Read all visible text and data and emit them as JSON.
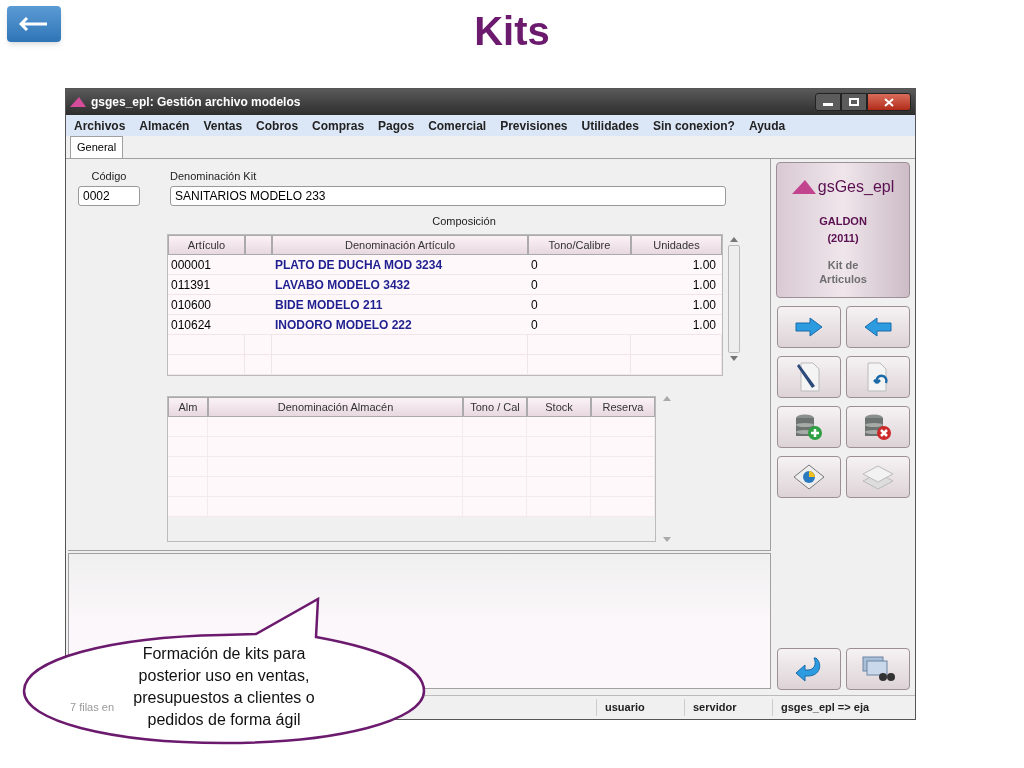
{
  "slide": {
    "title": "Kits"
  },
  "window": {
    "title": "gsges_epl: Gestión archivo modelos"
  },
  "menu": [
    "Archivos",
    "Almacén",
    "Ventas",
    "Cobros",
    "Compras",
    "Pagos",
    "Comercial",
    "Previsiones",
    "Utilidades",
    "Sin conexion?",
    "Ayuda"
  ],
  "tabs": [
    {
      "label": "General",
      "selected": true
    }
  ],
  "fields": [
    {
      "label": "Código",
      "value": "0002"
    },
    {
      "label": "Denominación Kit",
      "value": "SANITARIOS MODELO 233"
    }
  ],
  "composition": {
    "title": "Composición",
    "columns": [
      "Artículo",
      "Denominación Artículo",
      "Tono/Calibre",
      "Unidades"
    ],
    "rows": [
      {
        "articulo": "000001",
        "denominacion": "PLATO DE DUCHA MOD 3234",
        "tono": "0",
        "unidades": "1.00"
      },
      {
        "articulo": "011391",
        "denominacion": "LAVABO MODELO 3432",
        "tono": "0",
        "unidades": "1.00"
      },
      {
        "articulo": "010600",
        "denominacion": "BIDE MODELO 211",
        "tono": "0",
        "unidades": "1.00"
      },
      {
        "articulo": "010624",
        "denominacion": "INODORO MODELO 222",
        "tono": "0",
        "unidades": "1.00"
      }
    ]
  },
  "stock_table": {
    "columns": [
      "Alm",
      "Denominación Almacén",
      "Tono / Cal",
      "Stock",
      "Reserva"
    ]
  },
  "side_panel": {
    "brand": "gsGes_epl",
    "company": "GALDON",
    "year": "(2011)",
    "module": "Kit de Articulos"
  },
  "status_bar": {
    "records": "7 filas en",
    "user": "usuario",
    "server": "servidor",
    "connection": "gsges_epl => eja"
  },
  "callout": {
    "text": "Formación de kits para posterior uso en ventas, presupuestos a clientes o pedidos de forma ágil"
  }
}
